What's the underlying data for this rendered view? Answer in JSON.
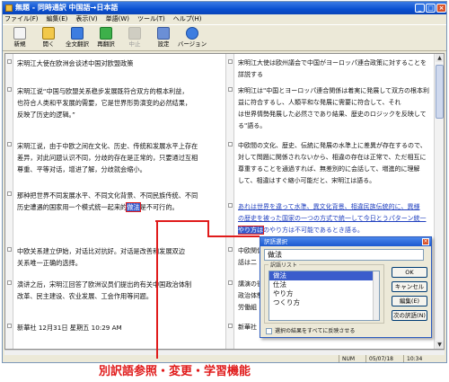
{
  "window": {
    "title": "無題 - 同時通訳 中国語→日本語",
    "controls": [
      "_",
      "□",
      "×"
    ]
  },
  "menu": [
    "ファイル(F)",
    "編集(E)",
    "表示(V)",
    "単語(W)",
    "ツール(T)",
    "ヘルプ(H)"
  ],
  "toolbar": [
    {
      "label": "新規",
      "icon": "new-icon",
      "color": "#f4f4f4"
    },
    {
      "label": "開く",
      "icon": "open-folder-icon",
      "color": "#f2c84a"
    },
    {
      "label": "全文翻訳",
      "icon": "translate-all-icon",
      "color": "#3d7de0"
    },
    {
      "label": "再翻訳",
      "icon": "retranslate-icon",
      "color": "#3db04a"
    },
    {
      "label": "中止",
      "icon": "stop-icon",
      "color": "#9a9a9a"
    },
    {
      "label": "設定",
      "icon": "settings-icon",
      "color": "#6b8fd6"
    },
    {
      "label": "バージョン",
      "icon": "help-icon",
      "color": "#3d7de0"
    }
  ],
  "source_paragraphs": [
    [
      "宋明江大使在欧洲会谈述中国对欧盟政策"
    ],
    [
      "宋明江说“中国与欧盟关系稳步发展既符合双方的根本利益，",
      "也符合人类和平发展的需要，它是世界形势演变的必然结果，",
      "反映了历史的逻辑。”"
    ],
    [
      "宋明江说，由于中欧之间在文化、历史、传统和发展水平上存在",
      "差异，对此问题认识不同，分歧的存在是正常的，只要通过互相",
      "尊重、平等对话，增进了解，分歧就会缩小。"
    ],
    [
      "那种把世界不同发展水平、不同文化背景、不同民族传统、不同",
      "历史遭遇的国家用一个模式统一起来的"
    ],
    [
      "中欧关系建立伊始，对话比对抗好。对话是改善和发展双边",
      "关系唯一正确的选择。"
    ],
    [
      "演讲之后，宋明江回答了欧洲议员们提出的有关中国政治体制",
      "改革、民主建设、农业发展、工会作用等问题。"
    ],
    [
      "新華社 12月31日 星期五 10:29 AM"
    ]
  ],
  "source_highlight": {
    "word": "做法",
    "trailing": "是不可行的。"
  },
  "target_paragraphs": [
    [
      "宋明江大使は欧州議会で中国がヨーロッパ連合政策に対することを",
      "詳説する"
    ],
    [
      "宋明江は\"中国とヨーロッパ連合関係は着実に発展して双方の根本利",
      "益に符合するし、人類平和な発展に需要に符合して、それ",
      "は世界情勢発展した必然さであり結果、歴史のロジックを反映して",
      "る\"語る。"
    ],
    [
      "中欧間の文化、歴史、伝統に発展の水準上に差異が存在するので、",
      "対して問題に関係されないから、相違の存在は正常で、ただ相互に",
      "尊重することを通過すれば、無差別的に会話して、増進的に理解",
      "して、相違はすぐ縮小可能だと、宋明江は語る。"
    ],
    [
      "あれは世界を違って水準、異文化背景、相違民族伝統的に、異様",
      "の歴史を被った国家の一つの方式で統一して今日とうパターン統一",
      "のやり方は不可能であるとき語る。"
    ],
    [
      "中欧関係",
      "話は二"
    ],
    [
      "講演の後",
      "政治体制",
      "労働組"
    ],
    [
      "新華社 12"
    ]
  ],
  "target_highlight": {
    "word": "やり方は"
  },
  "dialog": {
    "title": "訳語選択",
    "word": "做法",
    "group_label": "訳語リスト",
    "options": [
      "做法",
      "仕法",
      "やり方",
      "つくり方"
    ],
    "selected_index": 0,
    "buttons": [
      "OK",
      "キャンセル",
      "編集(E)",
      "次の訳語(N)"
    ],
    "checkbox_label": "選択の結果をすべてに反映させる"
  },
  "status": {
    "num": "NUM",
    "date": "05/07/18",
    "time": "10:34"
  },
  "caption": "別訳語参照・変更・学習機能",
  "colors": {
    "accent": "#e01b1b",
    "selection": "#3a5ccc",
    "link_text": "#1f3fbf",
    "titlebar": "#0a4fd0"
  }
}
